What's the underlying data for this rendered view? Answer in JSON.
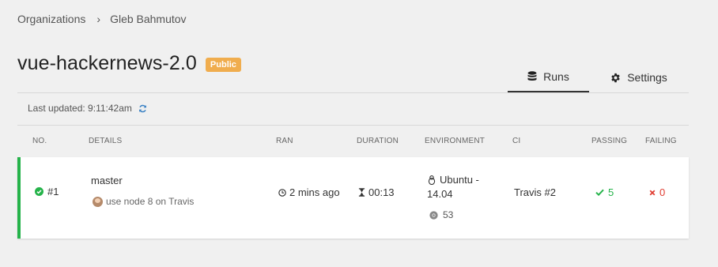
{
  "breadcrumb": {
    "org_label": "Organizations",
    "separator": "›",
    "user": "Gleb Bahmutov"
  },
  "project": {
    "title": "vue-hackernews-2.0",
    "visibility": "Public"
  },
  "tabs": [
    {
      "label": "Runs",
      "icon": "database-icon",
      "active": true
    },
    {
      "label": "Settings",
      "icon": "gear-icon",
      "active": false
    }
  ],
  "status": {
    "last_updated": "Last updated: 9:11:42am",
    "refresh_icon": "refresh-icon"
  },
  "table": {
    "headers": {
      "no": "NO.",
      "details": "DETAILS",
      "ran": "RAN",
      "duration": "DURATION",
      "environment": "ENVIRONMENT",
      "ci": "CI",
      "passing": "PASSING",
      "failing": "FAILING"
    },
    "rows": [
      {
        "number": "#1",
        "branch": "master",
        "commit_message": "use node 8 on Travis",
        "ran": "2 mins ago",
        "duration": "00:13",
        "os_line1": "Ubuntu -",
        "os_line2": "14.04",
        "browser_version": "53",
        "ci": "Travis #2",
        "passing": "5",
        "failing": "0"
      }
    ]
  },
  "colors": {
    "accent_pass": "#25b34a",
    "accent_fail": "#e03c31",
    "badge": "#f0ad4e",
    "refresh": "#3b82c4"
  }
}
